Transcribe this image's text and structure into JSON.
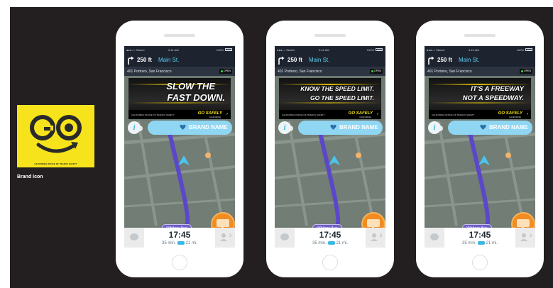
{
  "brand_icon": {
    "logo_text": "GO",
    "org_text": "CALIFORNIA OFFICE OF TRAFFIC SAFETY",
    "caption": "Brand Icon",
    "bg_color": "#f6e31b"
  },
  "status_bar": {
    "carrier": "●●●○○ Sketch",
    "time": "9:41 AM",
    "battery": "100%"
  },
  "nav": {
    "distance": "250 ft",
    "street": "Main St."
  },
  "place": {
    "address": "401 Portrero, San Francisco",
    "status": "OPEN"
  },
  "ad_footer": {
    "org": "CALIFORNIA OFFICE OF TRAFFIC SAFETY",
    "go_safely": "GO SAFELY",
    "state": "CALIFORNIA"
  },
  "brand_pill": {
    "label": "BRAND NAME"
  },
  "map": {
    "street_label": "Whiters Ave"
  },
  "trip": {
    "eta": "17:45",
    "duration": "35 min.",
    "distance": "21 mi.",
    "users": "3"
  },
  "screens": [
    {
      "line1": "SLOW THE",
      "line2": "FAST DOWN."
    },
    {
      "line1": "KNOW THE SPEED LIMIT.",
      "line2": "GO THE SPEED LIMIT."
    },
    {
      "line1": "IT'S A FREEWAY",
      "line2": "NOT A SPEEDWAY."
    }
  ],
  "colors": {
    "accent_blue": "#5ecdf0",
    "route_purple": "#5b47c9",
    "report_orange": "#f08c22",
    "nav_dark": "#1d2430"
  }
}
